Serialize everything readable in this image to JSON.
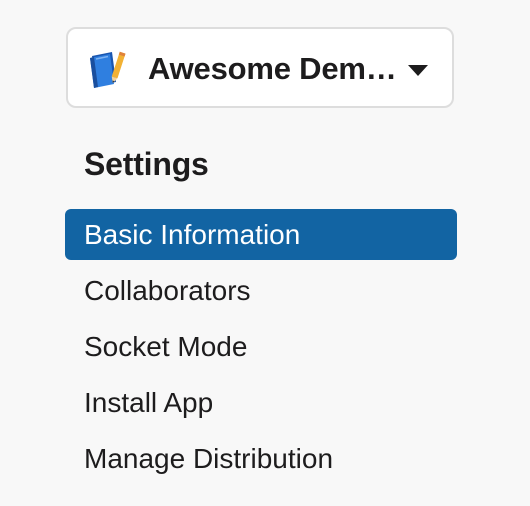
{
  "app_switcher": {
    "app_name": "Awesome Dem…",
    "icon": "notebook-app-icon",
    "dropdown_icon": "caret-down-icon"
  },
  "settings": {
    "title": "Settings",
    "items": [
      {
        "label": "Basic Information",
        "active": true
      },
      {
        "label": "Collaborators",
        "active": false
      },
      {
        "label": "Socket Mode",
        "active": false
      },
      {
        "label": "Install App",
        "active": false
      },
      {
        "label": "Manage Distribution",
        "active": false
      }
    ]
  },
  "colors": {
    "background": "#f8f8f8",
    "active_item": "#1264a3",
    "active_text": "#ffffff",
    "text": "#1d1c1d"
  }
}
